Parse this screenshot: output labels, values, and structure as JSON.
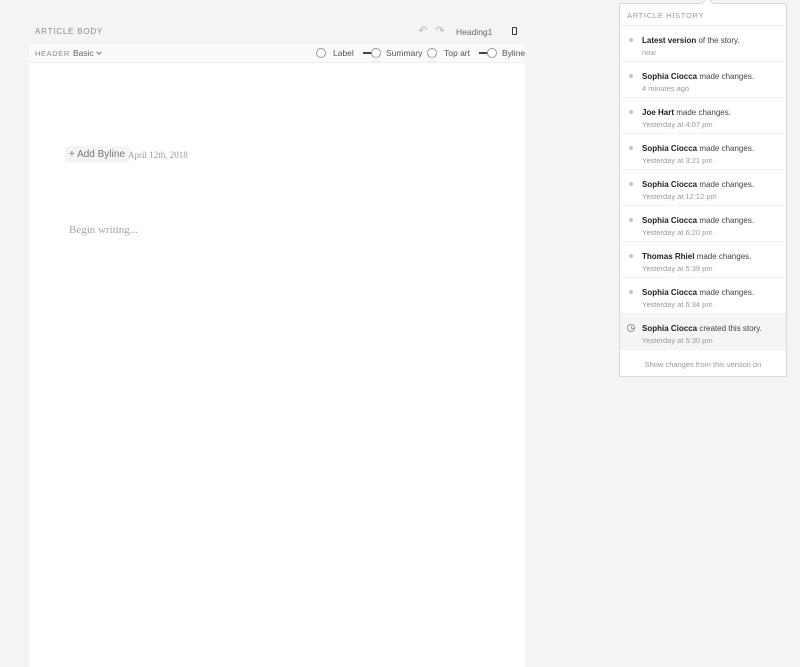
{
  "editor": {
    "section_title": "ARTICLE BODY",
    "text_style": "Heading1",
    "icons": {
      "undo": "undo-icon",
      "redo": "redo-icon",
      "device": "mobile-preview-icon"
    }
  },
  "toolbar": {
    "header_label": "HEADER",
    "header_style": "Basic",
    "options": [
      {
        "label": "Label",
        "on": false
      },
      {
        "label": "Summary",
        "on": true
      },
      {
        "label": "Top art",
        "on": false
      },
      {
        "label": "Byline",
        "on": true
      }
    ]
  },
  "article": {
    "add_byline": "+ Add Byline",
    "date": "April 12th, 2018",
    "body_placeholder": "Begin writing..."
  },
  "history": {
    "title": "ARTICLE HISTORY",
    "items": [
      {
        "author": "Latest version",
        "action": " of the story.",
        "time": "now"
      },
      {
        "author": "Sophia Ciocca",
        "action": " made changes.",
        "time": "4 minutes ago"
      },
      {
        "author": "Joe Hart",
        "action": " made changes.",
        "time": "Yesterday at 4:07 pm"
      },
      {
        "author": "Sophia Ciocca",
        "action": " made changes.",
        "time": "Yesterday at 3:21 pm"
      },
      {
        "author": "Sophia Ciocca",
        "action": " made changes.",
        "time": "Yesterday at 12:12 pm"
      },
      {
        "author": "Sophia Ciocca",
        "action": " made changes.",
        "time": "Yesterday at 6:20 pm"
      },
      {
        "author": "Thomas Rhiel",
        "action": " made changes.",
        "time": "Yesterday at 5:39 pm"
      },
      {
        "author": "Sophia Ciocca",
        "action": " made changes.",
        "time": "Yesterday at 5:34 pm"
      },
      {
        "author": "Sophia Ciocca",
        "action": " created this story.",
        "time": "Yesterday at 5:30 pm"
      }
    ],
    "footer": "Show changes from this version on"
  }
}
